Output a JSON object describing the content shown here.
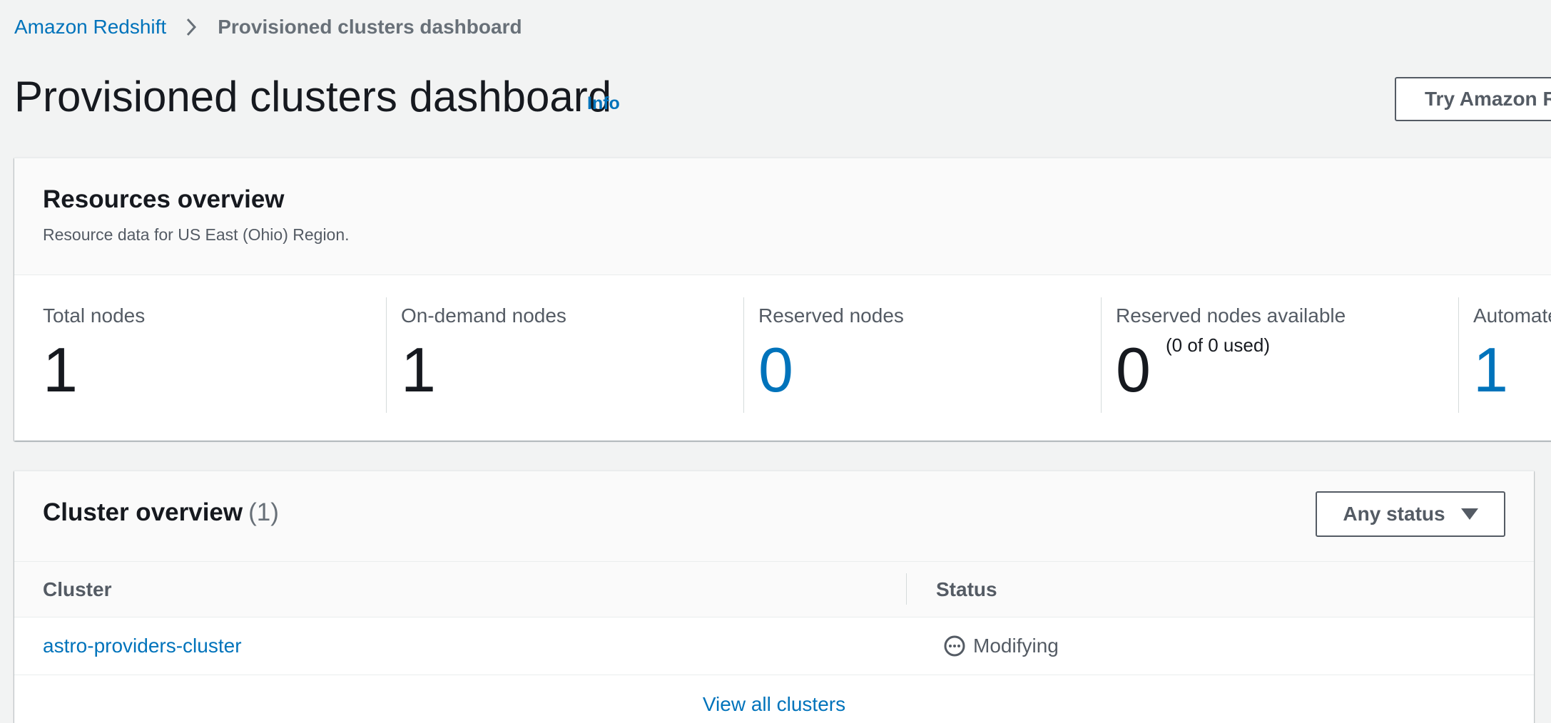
{
  "breadcrumb": {
    "root": "Amazon Redshift",
    "current": "Provisioned clusters dashboard"
  },
  "header": {
    "title": "Provisioned clusters dashboard",
    "info": "Info",
    "try_button": "Try Amazon Redshift Serverless"
  },
  "resources": {
    "title": "Resources overview",
    "description": "Resource data for US East (Ohio) Region.",
    "stats": [
      {
        "label": "Total nodes",
        "value": "1"
      },
      {
        "label": "On-demand nodes",
        "value": "1"
      },
      {
        "label": "Reserved nodes",
        "value": "0"
      },
      {
        "label": "Reserved nodes available",
        "value": "0",
        "sub": "(0 of 0 used)"
      },
      {
        "label": "Automated snapshots",
        "value": "1"
      }
    ]
  },
  "clusters": {
    "title": "Cluster overview",
    "count": "(1)",
    "filter": "Any status",
    "columns": {
      "cluster": "Cluster",
      "status": "Status"
    },
    "rows": [
      {
        "cluster": "astro-providers-cluster",
        "status": "Modifying"
      }
    ],
    "view_all": "View all clusters"
  },
  "colors": {
    "link": "#0073bb",
    "background": "#f2f3f3",
    "text": "#16191f",
    "muted": "#545b64"
  }
}
